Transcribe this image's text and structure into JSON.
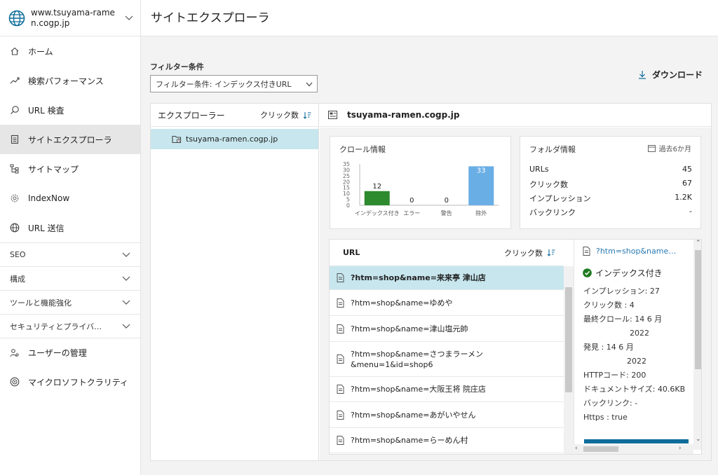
{
  "sidebar": {
    "site": "www.tsuyama-ramen.cogp.jp",
    "items": [
      {
        "label": "ホーム",
        "icon": "home-icon"
      },
      {
        "label": "検索パフォーマンス",
        "icon": "trend-icon"
      },
      {
        "label": "URL 検査",
        "icon": "search-icon"
      },
      {
        "label": "サイトエクスプローラ",
        "icon": "document-icon"
      },
      {
        "label": "サイトマップ",
        "icon": "sitemap-icon"
      },
      {
        "label": "IndexNow",
        "icon": "gear-icon"
      },
      {
        "label": "URL 送信",
        "icon": "globe-icon"
      }
    ],
    "sections": [
      "SEO",
      "構成",
      "ツールと機能強化",
      "セキュリティとプライバ…"
    ],
    "bottom_items": [
      {
        "label": "ユーザーの管理",
        "icon": "users-icon"
      },
      {
        "label": "マイクロソフトクラリティ",
        "icon": "clarity-icon"
      }
    ]
  },
  "page": {
    "title": "サイトエクスプローラ",
    "filter_label": "フィルター条件",
    "filter_value": "フィルター条件: インデックス付きURL",
    "download_label": "ダウンロード"
  },
  "tree": {
    "header": "エクスプローラー",
    "sort_label": "クリック数",
    "node": "tsuyama-ramen.cogp.jp"
  },
  "detail": {
    "host": "tsuyama-ramen.cogp.jp",
    "crawl_title": "クロール情報",
    "folder_title": "フォルダ情報",
    "folder_period": "過去6か月",
    "folder_stats": [
      {
        "label": "URLs",
        "value": "45"
      },
      {
        "label": "クリック数",
        "value": "67"
      },
      {
        "label": "インプレッション",
        "value": "1.2K"
      },
      {
        "label": "バックリンク",
        "value": "-"
      }
    ]
  },
  "chart_data": {
    "type": "bar",
    "title": "クロール情報",
    "categories": [
      "インデックス付き",
      "エラー",
      "警告",
      "除外"
    ],
    "values": [
      12,
      0,
      0,
      33
    ],
    "colors": [
      "#2d8a2d",
      "#2d8a2d",
      "#2d8a2d",
      "#6aaee6"
    ],
    "ylim": [
      0,
      35
    ],
    "yticks": [
      "35",
      "30",
      "25",
      "20",
      "15",
      "10",
      "5",
      "0"
    ],
    "ytick_values": [
      35,
      30,
      25,
      20,
      15,
      10,
      5,
      0
    ]
  },
  "url_list": {
    "header": "URL",
    "sort_label": "クリック数",
    "rows": [
      "?htm=shop&name=来来亭 津山店",
      "?htm=shop&name=ゆめや",
      "?htm=shop&name=津山塩元帥",
      "?htm=shop&name=さつまラーメン&menu=1&id=shop6",
      "?htm=shop&name=大阪王将 院庄店",
      "?htm=shop&name=あがいやせん",
      "?htm=shop&name=らーめん村"
    ]
  },
  "info": {
    "link": "?htm=shop&name…",
    "status": "インデックス付き",
    "rows": [
      "インプレッション: 27",
      "クリック数 : 4",
      "最終クロール: 14 6 月",
      "2022",
      "発見           : 14 6 月",
      "2022",
      "HTTPコード: 200",
      "ドキュメントサイズ: 40.6KB",
      "バックリンク: -",
      "Https        : true"
    ]
  },
  "colors": {
    "accent": "#0f6c9b",
    "selected_row": "#c7e6ee",
    "bar_indexed": "#2d8a2d",
    "bar_excluded": "#6aaee6"
  }
}
